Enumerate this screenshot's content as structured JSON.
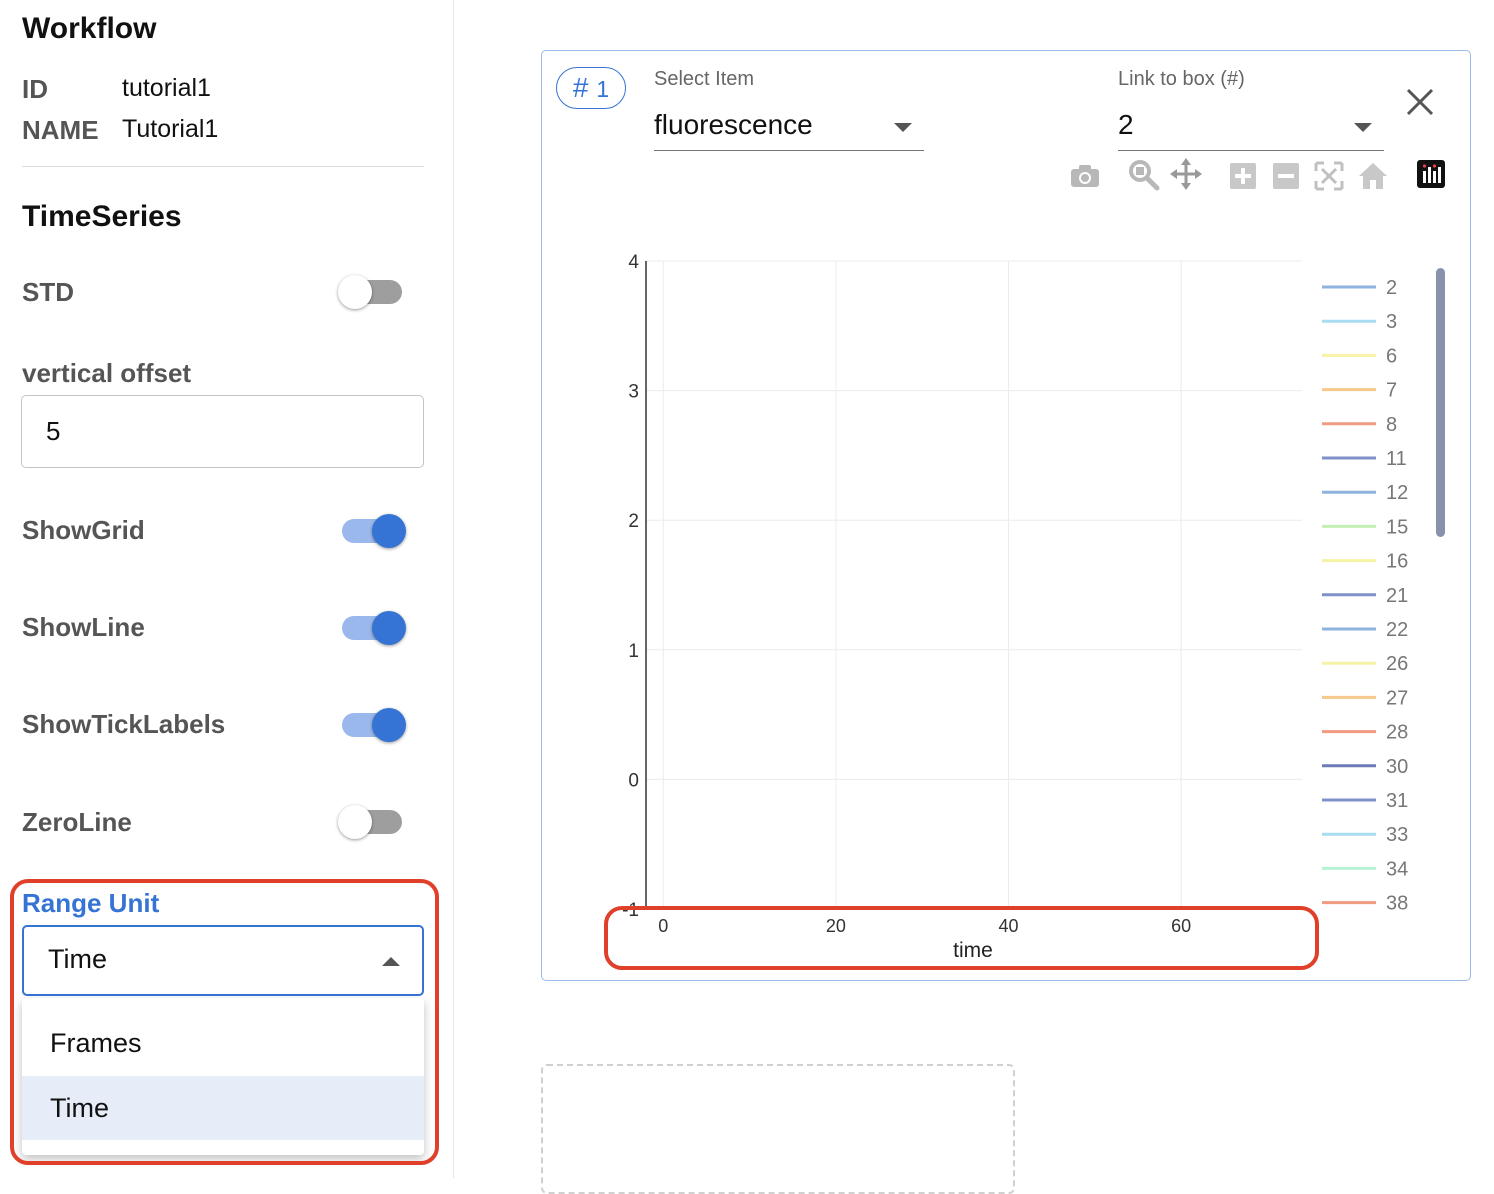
{
  "workflow": {
    "title": "Workflow",
    "id_label": "ID",
    "id_value": "tutorial1",
    "name_label": "NAME",
    "name_value": "Tutorial1"
  },
  "timeseries": {
    "title": "TimeSeries",
    "std": {
      "label": "STD",
      "on": false
    },
    "vertical_offset": {
      "label": "vertical offset",
      "value": "5"
    },
    "show_grid": {
      "label": "ShowGrid",
      "on": true
    },
    "show_line": {
      "label": "ShowLine",
      "on": true
    },
    "show_tick_labels": {
      "label": "ShowTickLabels",
      "on": true
    },
    "zero_line": {
      "label": "ZeroLine",
      "on": false
    },
    "range_unit": {
      "label": "Range Unit",
      "value": "Time",
      "options": [
        "Frames",
        "Time"
      ],
      "selected_option": "Time"
    }
  },
  "box": {
    "number_symbol": "#",
    "number": "1",
    "select_item_label": "Select Item",
    "select_item_value": "fluorescence",
    "link_label": "Link to box (#)",
    "link_value": "2",
    "toolbar_icons": [
      "camera-icon",
      "zoom-icon",
      "pan-icon",
      "zoom-in-icon",
      "zoom-out-icon",
      "autoscale-icon",
      "reset-axes-icon",
      "plotly-logo-icon"
    ]
  },
  "chart_data": {
    "type": "line",
    "title": "",
    "xlabel": "time",
    "ylabel": "",
    "x_ticks": [
      "0",
      "20",
      "40",
      "60"
    ],
    "y_ticks": [
      "4",
      "3",
      "2",
      "1",
      "0",
      "-1"
    ],
    "xlim": [
      -2,
      74
    ],
    "ylim": [
      -1,
      4
    ],
    "grid": true,
    "legend_placement": "right",
    "series": [
      {
        "name": "2",
        "color": "#8fb3dc"
      },
      {
        "name": "3",
        "color": "#a8dcf1"
      },
      {
        "name": "6",
        "color": "#f6f3a6"
      },
      {
        "name": "7",
        "color": "#f6c88a"
      },
      {
        "name": "8",
        "color": "#f09a80"
      },
      {
        "name": "11",
        "color": "#7f91c8"
      },
      {
        "name": "12",
        "color": "#8fb3dc"
      },
      {
        "name": "15",
        "color": "#c4efb6"
      },
      {
        "name": "16",
        "color": "#f6f3a6"
      },
      {
        "name": "21",
        "color": "#7f91c8"
      },
      {
        "name": "22",
        "color": "#8fb3dc"
      },
      {
        "name": "26",
        "color": "#f6f3a6"
      },
      {
        "name": "27",
        "color": "#f6c88a"
      },
      {
        "name": "28",
        "color": "#f09a80"
      },
      {
        "name": "30",
        "color": "#6c7bb8"
      },
      {
        "name": "31",
        "color": "#7f91c8"
      },
      {
        "name": "33",
        "color": "#a8dcf1"
      },
      {
        "name": "34",
        "color": "#b6f2d4"
      },
      {
        "name": "38",
        "color": "#f09a80"
      }
    ]
  },
  "colors": {
    "accent": "#3573d5",
    "highlight_red": "#e0402a",
    "toggle_track_on": "#9bb8ec",
    "toggle_track_off": "#9e9e9e"
  }
}
